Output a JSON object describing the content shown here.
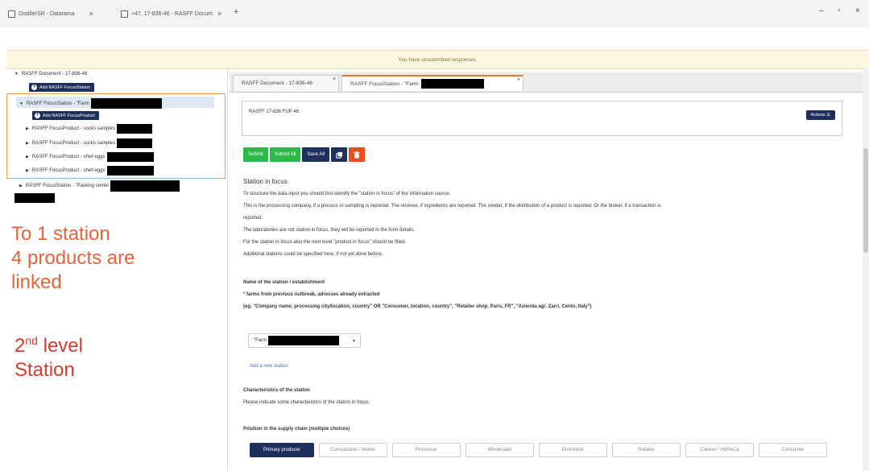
{
  "browser": {
    "tabs": [
      {
        "title": "DistillerSR - Datarama"
      },
      {
        "title": "+47, 17-836-46 - RASFF Docum"
      }
    ],
    "new_tab": "+",
    "window_controls": [
      "–",
      "▫",
      "×"
    ]
  },
  "notice": "You have unsubmitted responses.",
  "tree": {
    "root": "RASFF Document - 17-836-46",
    "add_station": "Add RASFF FocusStation",
    "station": "RASFF FocusStation - \"Farm",
    "add_product": "Add RASFF FocusProduct",
    "products": [
      "RASFF FocusProduct - socks samples",
      "RASFF FocusProduct - socks samples",
      "RASFF FocusProduct - shell eggs",
      "RASFF FocusProduct - shell eggs"
    ],
    "station2": "RASFF FocusStation - \"Packing center"
  },
  "annotations": {
    "line1": "To 1 station",
    "line2": "4 products are",
    "line3": "linked",
    "level_num": "2",
    "level_sup": "nd",
    "level_word": "level",
    "level_line2": "Station"
  },
  "doc_tabs": [
    {
      "label": "RASFF Document - 17-836-46",
      "close": "×"
    },
    {
      "label": "RASFF FocusStation - \"Farm",
      "close": "×"
    }
  ],
  "header": {
    "ref": "RASFF 17-836 FUP 46",
    "actions": "Actions ☰"
  },
  "buttons": {
    "submit": "Submit",
    "submit_all": "Submit All",
    "save_all": "Save All"
  },
  "content": {
    "title": "Station in focus",
    "p1": "To structure the data input you should first identify the \"station in focus\" of the information source.",
    "p2": "This is the processing company, if a process or sampling is reported. The receiver, if ingredients are reported. The sender, if the distribution of a product is reported. Or the broker, if a transaction is",
    "p2b": "reported.",
    "p3": "The laboratories are not station in focus, they will be reported in the form details.",
    "p4": "For the station in focus also the next level \"product in focus\" should be filled.",
    "p5": "Additional stations could be specified here, if not yet done before.",
    "name_label": "Name of the station / establishment",
    "name_note": "* farms from previous outbreak, adresses already extracted",
    "name_example": "(eg. \"Company name, processing city/location, country\" OR \"Consumer, location, country\", \"Retailer shop, Paris, FR\", \"Azienda agr. Zarri, Cento, Italy\")",
    "select_value": "\"Farm",
    "add_station_link": "Add a new station",
    "char_title": "Characteristics of the station",
    "char_desc": "Please indicate some characteristics of the station in focus.",
    "position_label": "Position in the supply chain (multiple choices)"
  },
  "supply_chain": [
    "Primary producer",
    "Consolidator / broker",
    "Processor",
    "Wholesaler",
    "Distributor",
    "Retailer",
    "Caterer / HoReCa",
    "Consumer"
  ]
}
